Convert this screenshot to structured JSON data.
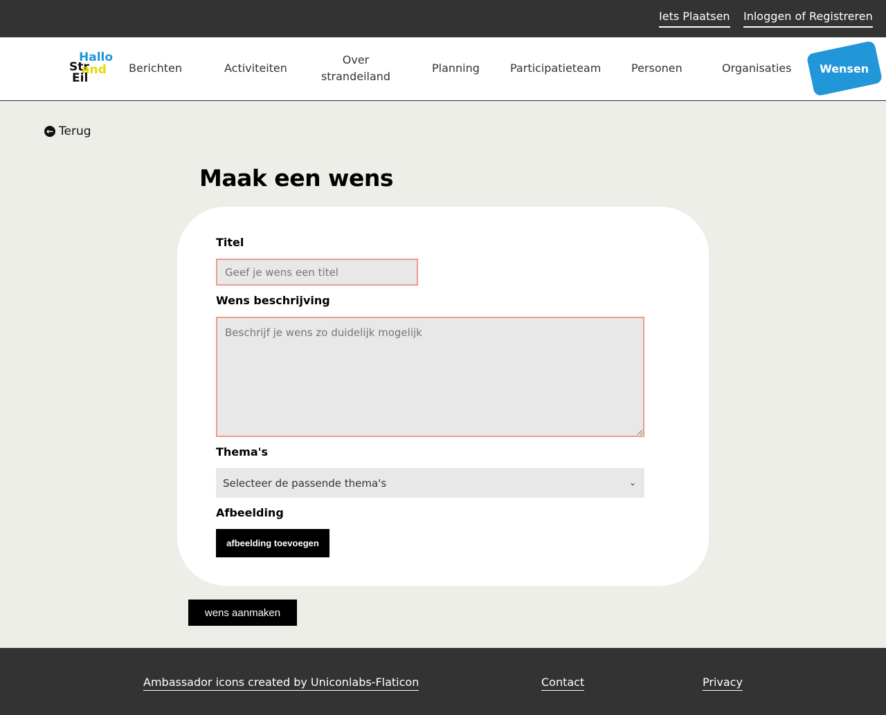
{
  "topbar": {
    "post_link": "Iets Plaatsen",
    "login_link": "Inloggen of Registreren"
  },
  "logo": {
    "line1": "Hallo",
    "line2": "Str",
    "line3": "and",
    "line4": "Eil"
  },
  "nav": {
    "items": [
      "Berichten",
      "Activiteiten",
      "Over",
      "strandeiland",
      "Planning",
      "Participatieteam",
      "Personen",
      "Organisaties"
    ],
    "active": "Wensen"
  },
  "back_label": "Terug",
  "page_title": "Maak een wens",
  "form": {
    "title_label": "Titel",
    "title_placeholder": "Geef je wens een titel",
    "desc_label": "Wens beschrijving",
    "desc_placeholder": "Beschrijf je wens zo duidelijk mogelijk",
    "themes_label": "Thema's",
    "themes_selected": "Selecteer de passende thema's",
    "image_label": "Afbeelding",
    "image_button": "afbeelding toevoegen",
    "submit_button": "wens aanmaken"
  },
  "footer": {
    "credit": "Ambassador icons created by Uniconlabs-Flaticon",
    "contact": "Contact",
    "privacy": "Privacy"
  },
  "colors": {
    "accent": "#2196d9",
    "logo_yellow": "#e8d800",
    "error_border": "#ef9a85",
    "dark": "#333333"
  }
}
